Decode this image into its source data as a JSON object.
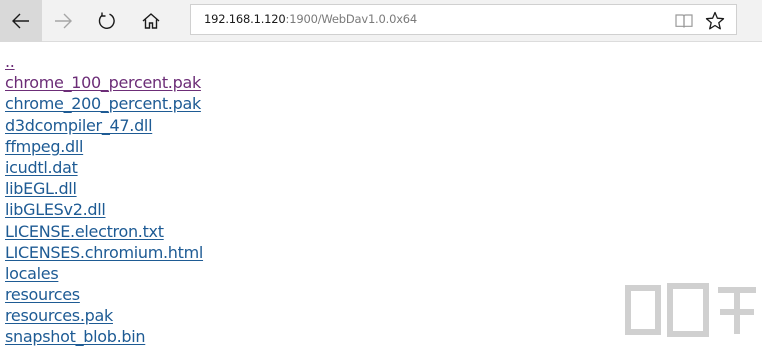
{
  "toolbar": {
    "back_icon": "arrow-left-icon",
    "forward_icon": "arrow-right-icon",
    "refresh_icon": "refresh-icon",
    "home_icon": "home-icon"
  },
  "address": {
    "host": "192.168.1.120",
    "rest": ":1900/WebDav1.0.0x64",
    "reading_view_icon": "book-icon",
    "favorite_icon": "star-icon"
  },
  "files": [
    {
      "label": "..",
      "visited": true
    },
    {
      "label": "chrome_100_percent.pak",
      "visited": true
    },
    {
      "label": "chrome_200_percent.pak",
      "visited": false
    },
    {
      "label": "d3dcompiler_47.dll",
      "visited": false
    },
    {
      "label": "ffmpeg.dll",
      "visited": false
    },
    {
      "label": "icudtl.dat",
      "visited": false
    },
    {
      "label": "libEGL.dll",
      "visited": false
    },
    {
      "label": "libGLESv2.dll",
      "visited": false
    },
    {
      "label": "LICENSE.electron.txt",
      "visited": false
    },
    {
      "label": "LICENSES.chromium.html",
      "visited": false
    },
    {
      "label": "locales",
      "visited": false
    },
    {
      "label": "resources",
      "visited": false
    },
    {
      "label": "resources.pak",
      "visited": false
    },
    {
      "label": "snapshot_blob.bin",
      "visited": false
    }
  ],
  "colors": {
    "link": "#1e5b94",
    "visited": "#6c2d77",
    "toolbar_bg": "#f2f2f2"
  }
}
